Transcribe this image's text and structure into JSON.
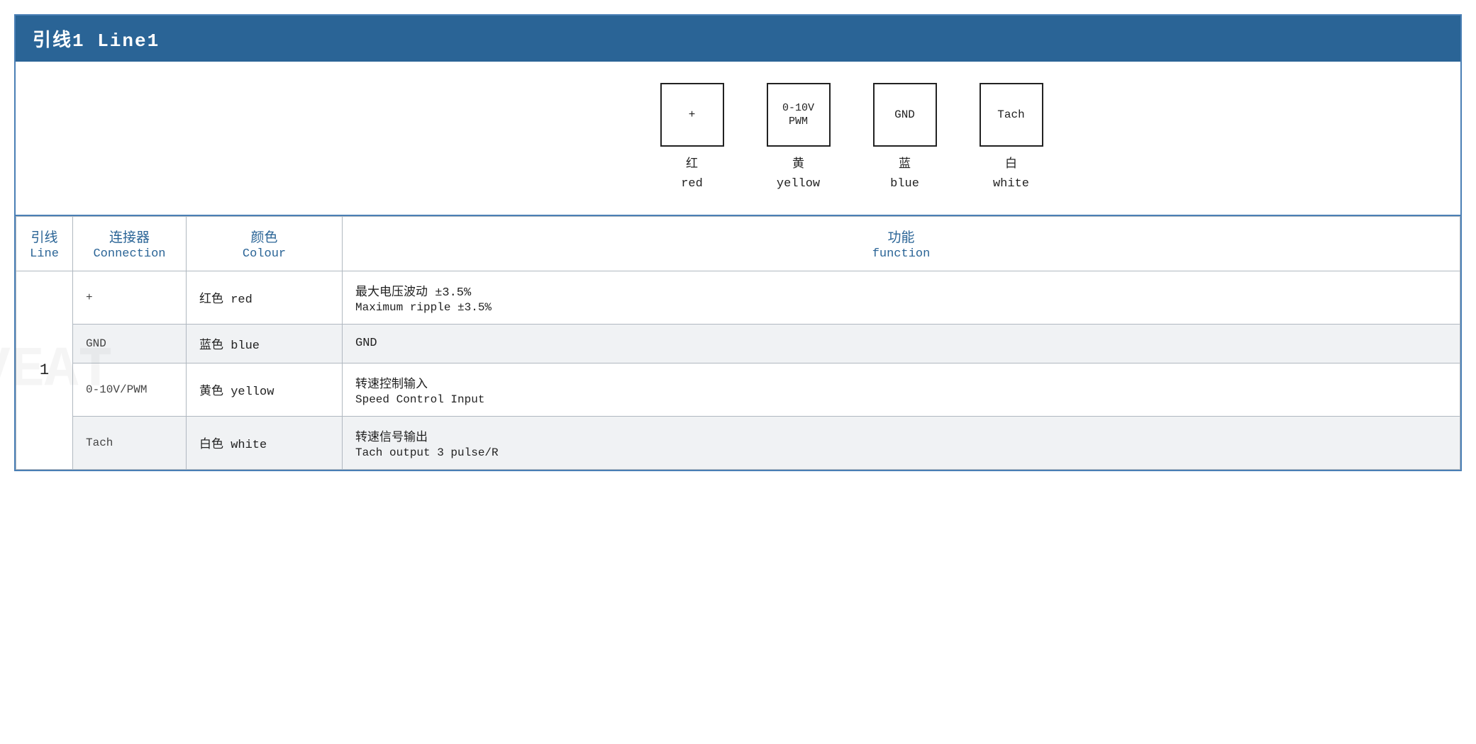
{
  "title": "引线1 Line1",
  "diagram": {
    "pins": [
      {
        "id": "plus",
        "symbol": "+",
        "zh": "红",
        "en": "red"
      },
      {
        "id": "pwm",
        "symbol": "0-10V\nPWM",
        "zh": "黄",
        "en": "yellow"
      },
      {
        "id": "gnd",
        "symbol": "GND",
        "zh": "蓝",
        "en": "blue"
      },
      {
        "id": "tach",
        "symbol": "Tach",
        "zh": "白",
        "en": "white"
      }
    ]
  },
  "table": {
    "headers": {
      "line": {
        "zh": "引线",
        "en": "Line"
      },
      "connection": {
        "zh": "连接器",
        "en": "Connection"
      },
      "colour": {
        "zh": "颜色",
        "en": "Colour"
      },
      "function": {
        "zh": "功能",
        "en": "function"
      }
    },
    "rows": [
      {
        "line": "1",
        "connection": "+",
        "colour": "红色 red",
        "func_zh": "最大电压波动 ±3.5%",
        "func_en": "Maximum ripple ±3.5%",
        "shaded": false
      },
      {
        "line": "1",
        "connection": "GND",
        "colour": "蓝色 blue",
        "func_zh": "GND",
        "func_en": "",
        "shaded": true
      },
      {
        "line": "1",
        "connection": "0-10V/PWM",
        "colour": "黄色 yellow",
        "func_zh": "转速控制输入",
        "func_en": "Speed Control Input",
        "shaded": false
      },
      {
        "line": "1",
        "connection": "Tach",
        "colour": "白色 white",
        "func_zh": "转速信号输出",
        "func_en": "Tach output 3 pulse/R",
        "shaded": true
      }
    ]
  }
}
